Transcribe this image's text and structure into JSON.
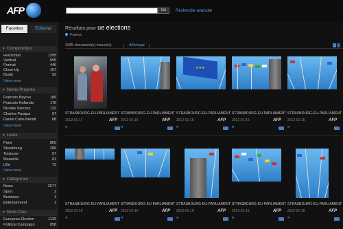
{
  "header": {
    "logo_text": "AFP",
    "search_value": "",
    "go_label": "Go",
    "advanced_search": "Recherche avancée"
  },
  "tabs": [
    {
      "label": "Facettes"
    },
    {
      "label": "Editorial"
    }
  ],
  "facets": [
    {
      "title": "Composition",
      "items": [
        {
          "label": "Horizontal",
          "count": "1395"
        },
        {
          "label": "Vertical",
          "count": "695"
        },
        {
          "label": "Portrait",
          "count": "446"
        },
        {
          "label": "Close-Up",
          "count": "167"
        },
        {
          "label": "Buste",
          "count": "52"
        }
      ]
    },
    {
      "title": "Noms Propres",
      "items": [
        {
          "label": "Francois Bayrou",
          "count": "186"
        },
        {
          "label": "Francois Hollande",
          "count": "176"
        },
        {
          "label": "Nicolas Sarkozy",
          "count": "132"
        },
        {
          "label": "Charles Pasqua",
          "count": "97"
        },
        {
          "label": "Daniel Cohn-Bendit",
          "count": "88"
        }
      ]
    },
    {
      "title": "Lieux",
      "items": [
        {
          "label": "Paris",
          "count": "800"
        },
        {
          "label": "Strasbourg",
          "count": "289"
        },
        {
          "label": "Toulouse",
          "count": "97"
        },
        {
          "label": "Marseille",
          "count": "81"
        },
        {
          "label": "Lille",
          "count": "72"
        }
      ]
    },
    {
      "title": "Catégories",
      "items": [
        {
          "label": "News",
          "count": "2077"
        },
        {
          "label": "Sport",
          "count": "2"
        },
        {
          "label": "Business",
          "count": "1"
        },
        {
          "label": "Entertainment",
          "count": "1"
        }
      ]
    },
    {
      "title": "Mots-Clés",
      "items": [
        {
          "label": "European Election",
          "count": "1125"
        },
        {
          "label": "Political Campaign",
          "count": "858"
        }
      ]
    }
  ],
  "view_more": "View more",
  "results": {
    "prefix": "Résultats pour",
    "query": "ue elections",
    "filter": "France",
    "count_text": "2085 document(s) trouvé(s)",
    "display_label": "Affichage"
  },
  "photos": [
    {
      "caption": "STRASBOURG-EU-PARLIAMENT",
      "date": "2012-01-17",
      "agency": "AFP"
    },
    {
      "caption": "STRASBOURG-EU-PARLIAMENT",
      "date": "2012-01-16",
      "agency": "AFP"
    },
    {
      "caption": "STRASBOURG-EU-PARLIAMENT",
      "date": "2012-01-16",
      "agency": "AFP"
    },
    {
      "caption": "STRASBOURG-EU-PARLIAMENT",
      "date": "2012-01-16",
      "agency": "AFP"
    },
    {
      "caption": "STRASBOURG-EU-PARLIAMENT",
      "date": "2012-01-16",
      "agency": "AFP"
    },
    {
      "caption": "STRASBOURG-EU-PARLIAMENT",
      "date": "2012-01-16",
      "agency": "AFP"
    },
    {
      "caption": "STRASBOURG-EU-PARLIAMENT",
      "date": "2012-01-16",
      "agency": "AFP"
    },
    {
      "caption": "STRASBOURG-EU-PARLIAMENT",
      "date": "2012-01-16",
      "agency": "AFP"
    },
    {
      "caption": "STRASBOURG-EU-PARLIAMENT",
      "date": "2012-01-16",
      "agency": "AFP"
    },
    {
      "caption": "STRASBOURG-EU-PARLIAMENT",
      "date": "2012-01-16",
      "agency": "AFP"
    }
  ],
  "colors": {
    "accent": "#5aa0e6",
    "background": "#111111",
    "sidebar": "#1a1a1a"
  }
}
